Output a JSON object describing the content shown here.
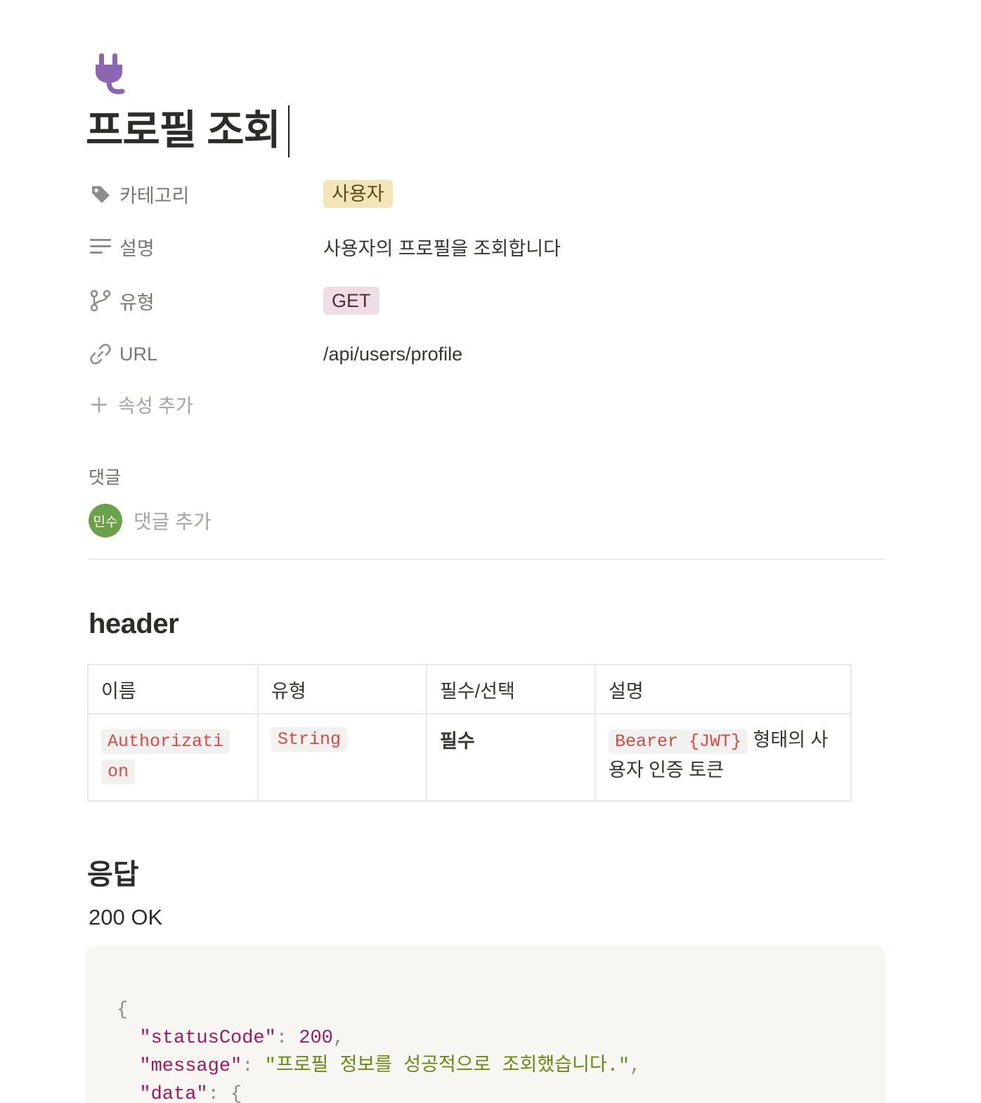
{
  "page": {
    "title": "프로필 조회",
    "icon": "electric-plug-icon"
  },
  "properties": {
    "category": {
      "label": "카테고리",
      "value": "사용자",
      "icon": "tag-icon",
      "tag_color": "#f3e5b9"
    },
    "description": {
      "label": "설명",
      "value": "사용자의 프로필을 조회합니다",
      "icon": "text-lines-icon"
    },
    "type": {
      "label": "유형",
      "value": "GET",
      "icon": "branch-icon",
      "tag_color": "#efdde6"
    },
    "url": {
      "label": "URL",
      "value": "/api/users/profile",
      "icon": "link-icon"
    },
    "add_property_label": "속성 추가"
  },
  "comments": {
    "label": "댓글",
    "avatar_initials": "민수",
    "avatar_color": "#6aa14a",
    "placeholder": "댓글 추가"
  },
  "header_section": {
    "heading": "header",
    "table": {
      "columns": [
        "이름",
        "유형",
        "필수/선택",
        "설명"
      ],
      "rows": [
        {
          "name": "Authorization",
          "type": "String",
          "required": "필수",
          "description_code": "Bearer {JWT}",
          "description_text": " 형태의 사용자 인증 토큰"
        }
      ]
    }
  },
  "response_section": {
    "heading": "응답",
    "status": "200 OK",
    "code": {
      "open_brace": "{",
      "lines": [
        {
          "key": "\"statusCode\"",
          "value": "200",
          "value_type": "number"
        },
        {
          "key": "\"message\"",
          "value": "\"프로필 정보를 성공적으로 조회했습니다.\"",
          "value_type": "string"
        },
        {
          "key": "\"data\"",
          "value": "{",
          "value_type": "punct"
        }
      ]
    }
  }
}
